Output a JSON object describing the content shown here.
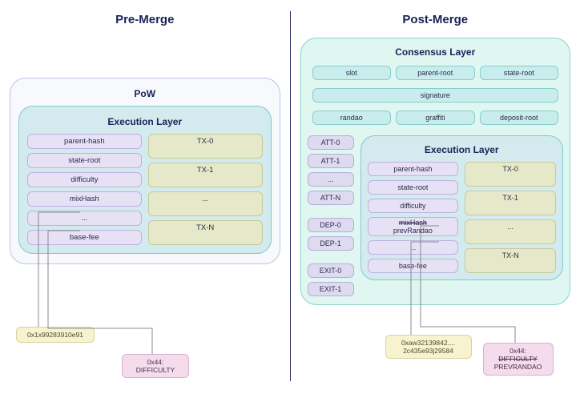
{
  "left": {
    "title": "Pre-Merge",
    "pow_label": "PoW",
    "exec_label": "Execution Layer",
    "header_fields": [
      "parent-hash",
      "state-root",
      "difficulty",
      "mixHash",
      "...",
      "base-fee"
    ],
    "tx_fields": [
      "TX-0",
      "TX-1",
      "...",
      "TX-N"
    ],
    "callout_value": "0x1x99283910e91",
    "callout_opcode": "0x44:\nDIFFICULTY"
  },
  "right": {
    "title": "Post-Merge",
    "consensus_label": "Consensus Layer",
    "consensus_fields_row1": [
      "slot",
      "parent-root",
      "state-root"
    ],
    "consensus_fields_row2": [
      "signature"
    ],
    "consensus_fields_row3": [
      "randao",
      "graffiti",
      "deposit-root"
    ],
    "att_fields": [
      "ATT-0",
      "ATT-1",
      "...",
      "ATT-N"
    ],
    "dep_fields": [
      "DEP-0",
      "DEP-1"
    ],
    "exit_fields": [
      "EXIT-0",
      "EXIT-1"
    ],
    "exec_label": "Execution Layer",
    "header_fields": [
      "parent-hash",
      "state-root",
      "difficulty",
      "mixHash",
      "prevRandao",
      "...",
      "base-fee"
    ],
    "header_strike": "mixHash",
    "tx_fields": [
      "TX-0",
      "TX-1",
      "...",
      "TX-N"
    ],
    "callout_value": "0xaw32139842....\n2c435e93j29584",
    "callout_opcode_label": "0x44:",
    "callout_opcode_old": "DIFFICULTY",
    "callout_opcode_new": "PREVRANDAO"
  }
}
